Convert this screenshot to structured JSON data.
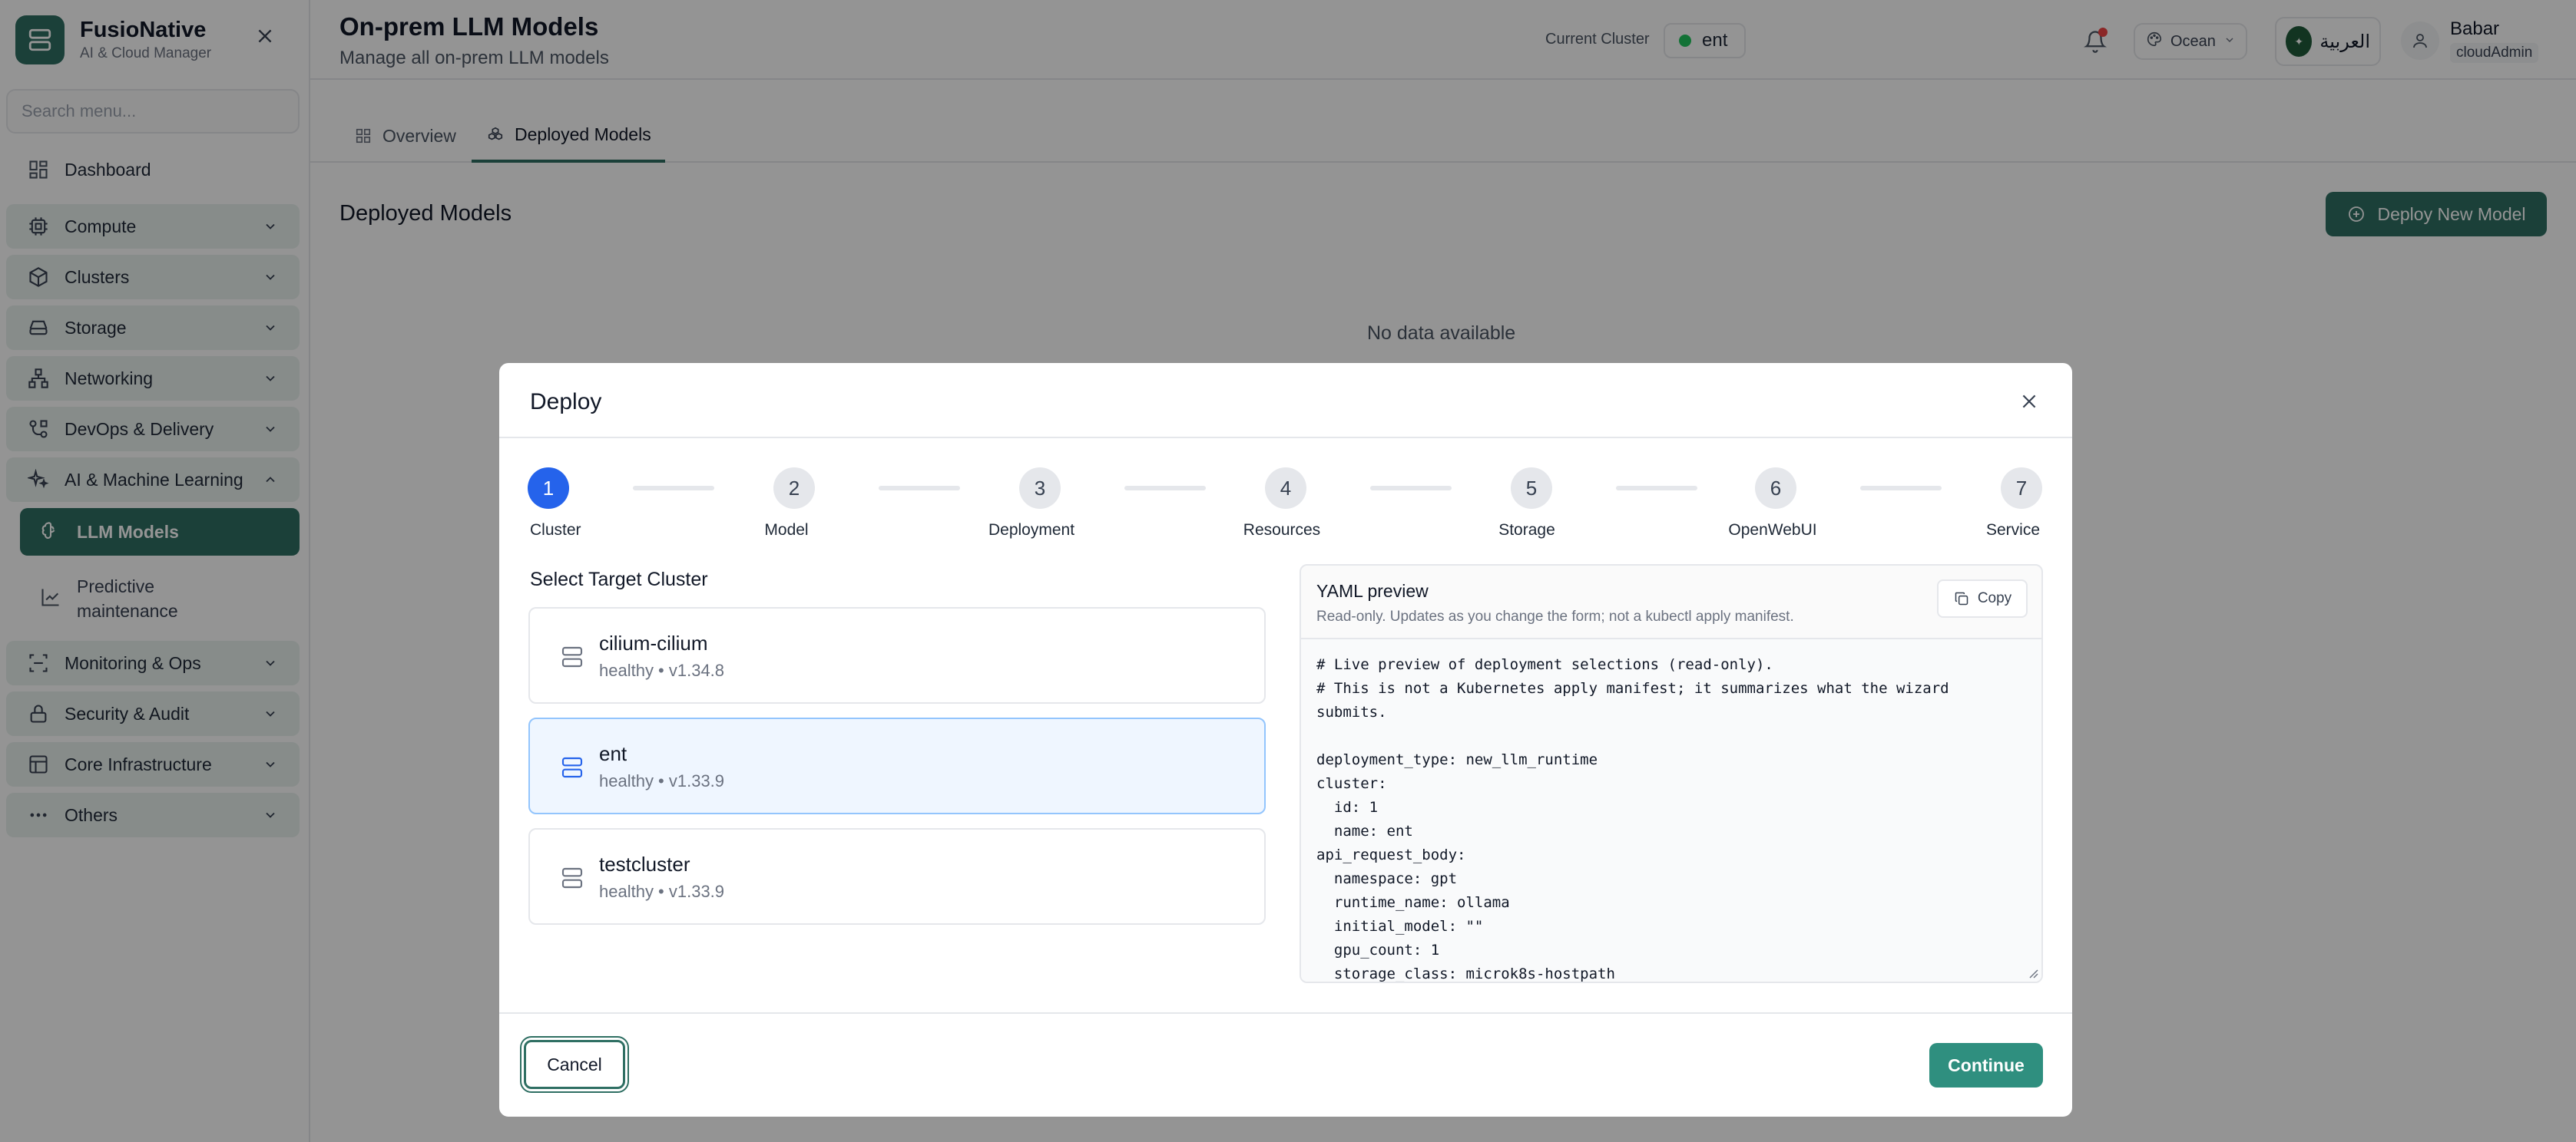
{
  "sidebar": {
    "brand_name": "FusioNative",
    "brand_sub": "AI & Cloud Manager",
    "search_placeholder": "Search menu...",
    "items": [
      {
        "label": "Dashboard"
      },
      {
        "label": "Compute"
      },
      {
        "label": "Clusters"
      },
      {
        "label": "Storage"
      },
      {
        "label": "Networking"
      },
      {
        "label": "DevOps & Delivery"
      },
      {
        "label": "AI & Machine Learning"
      },
      {
        "label": "Monitoring & Ops"
      },
      {
        "label": "Security & Audit"
      },
      {
        "label": "Core Infrastructure"
      },
      {
        "label": "Others"
      }
    ],
    "subitems": [
      {
        "label": "LLM Models"
      },
      {
        "label": "Predictive maintenance"
      }
    ]
  },
  "header": {
    "title": "On-prem LLM Models",
    "subtitle": "Manage all on-prem LLM models",
    "cluster_label": "Current Cluster",
    "cluster_value": "ent",
    "theme": "Ocean",
    "language": "العربية",
    "user_name": "Babar",
    "user_role": "cloudAdmin"
  },
  "main": {
    "tabs": [
      {
        "label": "Overview"
      },
      {
        "label": "Deployed Models"
      }
    ],
    "section_title": "Deployed Models",
    "deploy_button": "Deploy New Model",
    "empty_text": "No data available"
  },
  "modal": {
    "title": "Deploy",
    "steps": [
      {
        "num": "1",
        "label": "Cluster"
      },
      {
        "num": "2",
        "label": "Model"
      },
      {
        "num": "3",
        "label": "Deployment"
      },
      {
        "num": "4",
        "label": "Resources"
      },
      {
        "num": "5",
        "label": "Storage"
      },
      {
        "num": "6",
        "label": "OpenWebUI"
      },
      {
        "num": "7",
        "label": "Service"
      }
    ],
    "select_title": "Select Target Cluster",
    "clusters": [
      {
        "name": "cilium-cilium",
        "status": "healthy • v1.34.8"
      },
      {
        "name": "ent",
        "status": "healthy • v1.33.9"
      },
      {
        "name": "testcluster",
        "status": "healthy • v1.33.9"
      }
    ],
    "yaml_title": "YAML preview",
    "yaml_sub": "Read-only. Updates as you change the form; not a kubectl apply manifest.",
    "copy_label": "Copy",
    "yaml_text": "# Live preview of deployment selections (read-only).\n# This is not a Kubernetes apply manifest; it summarizes what the wizard submits.\n\ndeployment_type: new_llm_runtime\ncluster:\n  id: 1\n  name: ent\napi_request_body:\n  namespace: gpt\n  runtime_name: ollama\n  initial_model: \"\"\n  gpu_count: 1\n  storage_class: microk8s-hostpath",
    "cancel_label": "Cancel",
    "continue_label": "Continue"
  },
  "colors": {
    "brand": "#2f6f63",
    "active_step": "#2563eb",
    "continue": "#2f8f7f",
    "status_dot": "#22c55e",
    "notification": "#ef4444"
  }
}
